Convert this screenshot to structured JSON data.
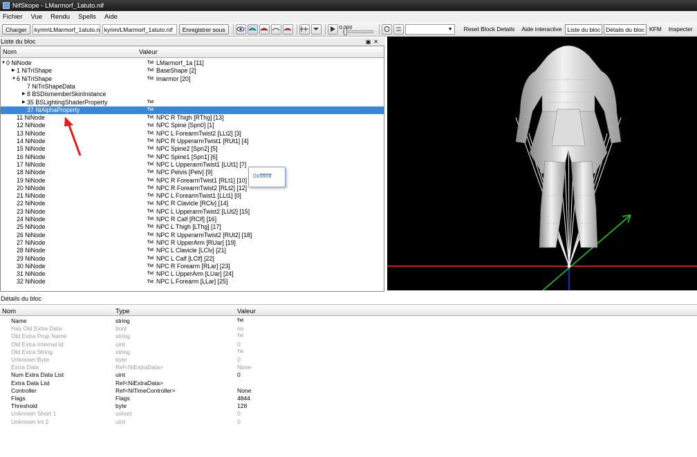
{
  "window": {
    "title": "NifSkope - LMarmorf_1atuto.nif"
  },
  "menu": [
    "Fichier",
    "Vue",
    "Rendu",
    "Spells",
    "Aide"
  ],
  "toolbar": {
    "load_label": "Charger",
    "path1": "kyrim\\LMarmorf_1atuto.nif",
    "path2": "kyrim/LMarmorf_1atuto.nif",
    "save_label": "Enregistrer sous",
    "time_value": "0.000",
    "reset_block_details": "Reset Block Details",
    "interactive_help": "Aide interactive",
    "block_list": "Liste du bloc",
    "block_details": "Détails du bloc",
    "kfm": "KFM",
    "inspect": "Inspecter"
  },
  "tree_panel": {
    "title": "Liste du bloc",
    "col_name": "Nom",
    "col_value": "Valeur"
  },
  "tree_rows": [
    {
      "name": "0 NiNode",
      "value": "LMarmorf_1a [11]",
      "txt": true,
      "indent": 8,
      "arrow": "open"
    },
    {
      "name": "1 NiTriShape",
      "value": "BaseShape [2]",
      "txt": true,
      "indent": 23,
      "arrow": "closed"
    },
    {
      "name": "6 NiTriShape",
      "value": "lmarmor [20]",
      "txt": true,
      "indent": 23,
      "arrow": "open"
    },
    {
      "name": "7 NiTriShapeData",
      "value": "",
      "txt": false,
      "indent": 38,
      "arrow": ""
    },
    {
      "name": "8 BSDismemberSkinInstance",
      "value": "",
      "txt": false,
      "indent": 38,
      "arrow": "closed"
    },
    {
      "name": "35 BSLightingShaderProperty",
      "value": "",
      "txt": true,
      "indent": 38,
      "arrow": "closed"
    },
    {
      "name": "37 NiAlphaProperty",
      "value": "",
      "txt": true,
      "indent": 38,
      "arrow": "",
      "selected": true
    },
    {
      "name": "11 NiNode",
      "value": "NPC R Thigh [RThg] [13]",
      "txt": true,
      "indent": 23,
      "arrow": ""
    },
    {
      "name": "12 NiNode",
      "value": "NPC Spine [Spn0] [1]",
      "txt": true,
      "indent": 23,
      "arrow": ""
    },
    {
      "name": "13 NiNode",
      "value": "NPC L ForearmTwist2 [LLt2] [3]",
      "txt": true,
      "indent": 23,
      "arrow": ""
    },
    {
      "name": "14 NiNode",
      "value": "NPC R UpperarmTwist1 [RUt1] [4]",
      "txt": true,
      "indent": 23,
      "arrow": ""
    },
    {
      "name": "15 NiNode",
      "value": "NPC Spine2 [Spn2] [5]",
      "txt": true,
      "indent": 23,
      "arrow": ""
    },
    {
      "name": "16 NiNode",
      "value": "NPC Spine1 [Spn1] [6]",
      "txt": true,
      "indent": 23,
      "arrow": ""
    },
    {
      "name": "17 NiNode",
      "value": "NPC L UpperarmTwist1 [LUt1] [7]",
      "txt": true,
      "indent": 23,
      "arrow": ""
    },
    {
      "name": "18 NiNode",
      "value": "NPC Pelvis [Pelv] [9]",
      "txt": true,
      "indent": 23,
      "arrow": ""
    },
    {
      "name": "19 NiNode",
      "value": "NPC R ForearmTwist1 [RLt1] [10]",
      "txt": true,
      "indent": 23,
      "arrow": ""
    },
    {
      "name": "20 NiNode",
      "value": "NPC R ForearmTwist2 [RLt2] [12]",
      "txt": true,
      "indent": 23,
      "arrow": ""
    },
    {
      "name": "21 NiNode",
      "value": "NPC L ForearmTwist1 [LLt1] [0]",
      "txt": true,
      "indent": 23,
      "arrow": ""
    },
    {
      "name": "22 NiNode",
      "value": "NPC R Clavicle [RClv] [14]",
      "txt": true,
      "indent": 23,
      "arrow": ""
    },
    {
      "name": "23 NiNode",
      "value": "NPC L UpperarmTwist2 [LUt2] [15]",
      "txt": true,
      "indent": 23,
      "arrow": ""
    },
    {
      "name": "24 NiNode",
      "value": "NPC R Calf [RClf] [16]",
      "txt": true,
      "indent": 23,
      "arrow": ""
    },
    {
      "name": "25 NiNode",
      "value": "NPC L Thigh [LThg] [17]",
      "txt": true,
      "indent": 23,
      "arrow": ""
    },
    {
      "name": "26 NiNode",
      "value": "NPC R UpperarmTwist2 [RUt2] [18]",
      "txt": true,
      "indent": 23,
      "arrow": ""
    },
    {
      "name": "27 NiNode",
      "value": "NPC R UpperArm [RUar] [19]",
      "txt": true,
      "indent": 23,
      "arrow": ""
    },
    {
      "name": "28 NiNode",
      "value": "NPC L Clavicle [LClv] [21]",
      "txt": true,
      "indent": 23,
      "arrow": ""
    },
    {
      "name": "29 NiNode",
      "value": "NPC L Calf [LClf] [22]",
      "txt": true,
      "indent": 23,
      "arrow": ""
    },
    {
      "name": "30 NiNode",
      "value": "NPC R Forearm [RLar] [23]",
      "txt": true,
      "indent": 23,
      "arrow": ""
    },
    {
      "name": "31 NiNode",
      "value": "NPC L UpperArm [LUar] [24]",
      "txt": true,
      "indent": 23,
      "arrow": ""
    },
    {
      "name": "32 NiNode",
      "value": "NPC L Forearm [LLar] [25]",
      "txt": true,
      "indent": 23,
      "arrow": ""
    }
  ],
  "txt_label": "Txt",
  "tooltip": {
    "text": "0xffffffff"
  },
  "details_panel": {
    "title": "Détails du bloc",
    "col_name": "Nom",
    "col_type": "Type",
    "col_value": "Valeur"
  },
  "details_rows": [
    {
      "name": "Name",
      "type": "string",
      "value": "",
      "txt": true,
      "dim": false
    },
    {
      "name": "Has Old Extra Data",
      "type": "bool",
      "value": "no",
      "txt": false,
      "dim": true
    },
    {
      "name": "Old Extra Prop Name",
      "type": "string",
      "value": "",
      "txt": true,
      "dim": true
    },
    {
      "name": "Old Extra Internal Id",
      "type": "uint",
      "value": "0",
      "txt": false,
      "dim": true
    },
    {
      "name": "Old Extra String",
      "type": "string",
      "value": "",
      "txt": true,
      "dim": true
    },
    {
      "name": "Unknown Byte",
      "type": "byte",
      "value": "0",
      "txt": false,
      "dim": true
    },
    {
      "name": "Extra Data",
      "type": "Ref<NiExtraData>",
      "value": "None",
      "txt": false,
      "dim": true
    },
    {
      "name": "Num Extra Data List",
      "type": "uint",
      "value": "0",
      "txt": false,
      "dim": false
    },
    {
      "name": "Extra Data List",
      "type": "Ref<NiExtraData>",
      "value": "",
      "txt": false,
      "dim": false
    },
    {
      "name": "Controller",
      "type": "Ref<NiTimeController>",
      "value": "None",
      "txt": false,
      "dim": false
    },
    {
      "name": "Flags",
      "type": "Flags",
      "value": "4844",
      "txt": false,
      "dim": false
    },
    {
      "name": "Threshold",
      "type": "byte",
      "value": "128",
      "txt": false,
      "dim": false
    },
    {
      "name": "Unknown Short 1",
      "type": "ushort",
      "value": "0",
      "txt": false,
      "dim": true
    },
    {
      "name": "Unknown Int 2",
      "type": "uint",
      "value": "0",
      "txt": false,
      "dim": true
    }
  ],
  "colors": {
    "selection": "#3a87d9",
    "annotation_arrow": "#e8191b",
    "axis_x": "#ff2020",
    "axis_y": "#20d020",
    "axis_z": "#2040ff"
  }
}
